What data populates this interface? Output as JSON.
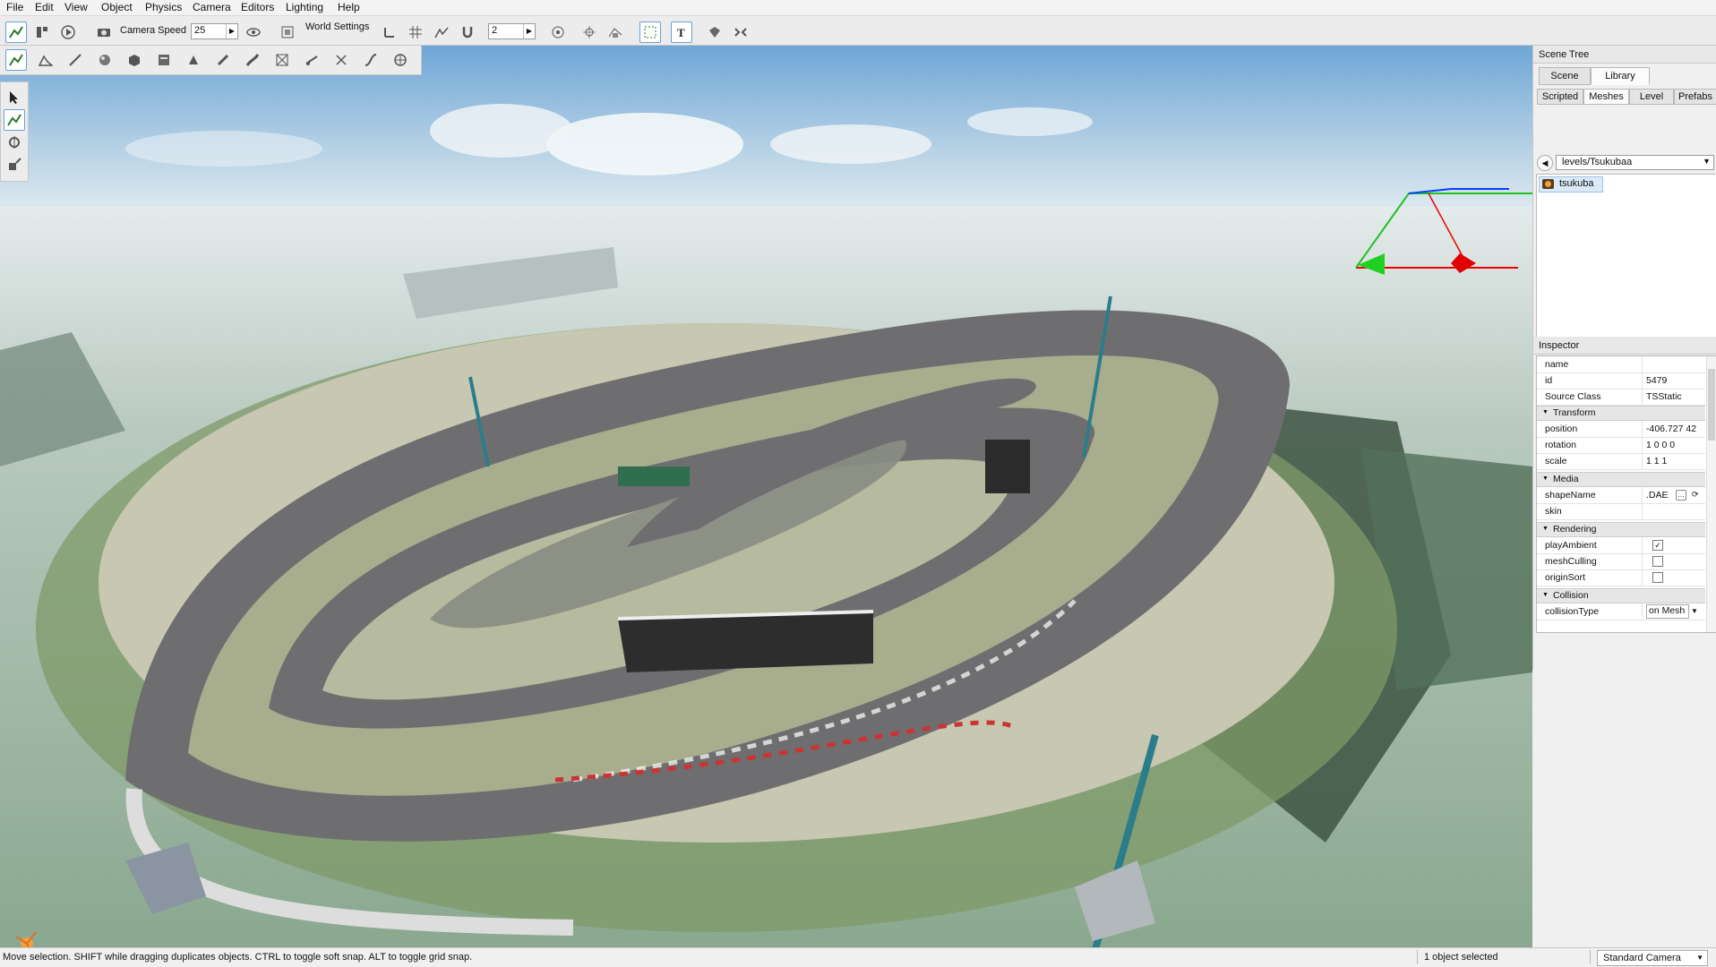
{
  "menu": [
    "File",
    "Edit",
    "View",
    "Object",
    "Physics",
    "Camera",
    "Editors",
    "Lighting",
    "Help"
  ],
  "toolbar": {
    "camera_speed_label": "Camera Speed",
    "camera_speed_value": "25",
    "world_settings_label": "World Settings",
    "grid_value": "2"
  },
  "scene_tree": {
    "title": "Scene Tree",
    "tabs": [
      "Scene",
      "Library"
    ],
    "subtabs": [
      "Scripted",
      "Meshes",
      "Level",
      "Prefabs"
    ],
    "path": "levels/Tsukubaa",
    "items": [
      {
        "label": "tsukuba"
      }
    ]
  },
  "inspector": {
    "title": "Inspector",
    "fields": {
      "name": {
        "key": "name",
        "value": ""
      },
      "id": {
        "key": "id",
        "value": "5479"
      },
      "source_class": {
        "key": "Source Class",
        "value": "TSStatic"
      },
      "position": {
        "key": "position",
        "value": "-406.727 42"
      },
      "rotation": {
        "key": "rotation",
        "value": "1 0 0 0"
      },
      "scale": {
        "key": "scale",
        "value": "1 1 1"
      },
      "shapeName": {
        "key": "shapeName",
        "value": ".DAE"
      },
      "skin": {
        "key": "skin",
        "value": ""
      },
      "playAmbient": {
        "key": "playAmbient",
        "value": "✓"
      },
      "meshCulling": {
        "key": "meshCulling",
        "value": ""
      },
      "originSort": {
        "key": "originSort",
        "value": ""
      },
      "collisionType": {
        "key": "collisionType",
        "value": "on Mesh"
      }
    },
    "groups": {
      "transform": "Transform",
      "media": "Media",
      "rendering": "Rendering",
      "collision": "Collision"
    }
  },
  "status": {
    "hint": "Move selection.  SHIFT while dragging duplicates objects.  CTRL to toggle soft snap.  ALT to toggle grid snap.",
    "selection": "1 object selected",
    "camera": "Standard Camera"
  },
  "colors": {
    "accent": "#6aa0d8",
    "selection": "#dceaf8"
  }
}
